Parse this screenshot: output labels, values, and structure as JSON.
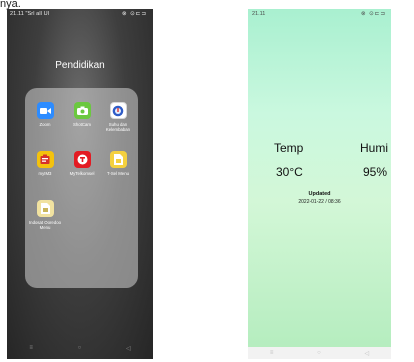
{
  "leading_text": "nya.",
  "left_phone": {
    "status": {
      "time": "21.11 \"Srl all Ul",
      "right_icons": "⊗ ⊙⊏⊐"
    },
    "folder_title": "Pendidikan",
    "apps": [
      {
        "label": "Zoom",
        "color": "#2D8CFF",
        "icon": "video-camera-icon"
      },
      {
        "label": "ShotCam",
        "color": "#6BC83F",
        "icon": "camera-icon"
      },
      {
        "label": "Suhu dan Kelembaban",
        "color": "#ffffff",
        "icon": "thermometer-icon"
      },
      {
        "label": "myIM3",
        "color": "#F4C20D",
        "icon": "im3-icon"
      },
      {
        "label": "MyTelkomsel",
        "color": "#E31B23",
        "icon": "telkomsel-icon"
      },
      {
        "label": "T-Sel Menu",
        "color": "#F4D03F",
        "icon": "sim-card-icon"
      },
      {
        "label": "Indosat Ooredoo Menu",
        "color": "#F1E2A0",
        "icon": "sim-card-icon"
      }
    ],
    "nav": {
      "menu": "≡",
      "home": "○",
      "back": "◁"
    }
  },
  "right_phone": {
    "status": {
      "time": "21.11",
      "right_icons": "⊗ ⊙⊏⊐"
    },
    "temp_label": "Temp",
    "humi_label": "Humi",
    "temp_value": "30°C",
    "humi_value": "95%",
    "updated_label": "Updated",
    "updated_time": "2022-01-22 / 08:36",
    "nav": {
      "menu": "≡",
      "home": "○",
      "back": "◁"
    }
  }
}
